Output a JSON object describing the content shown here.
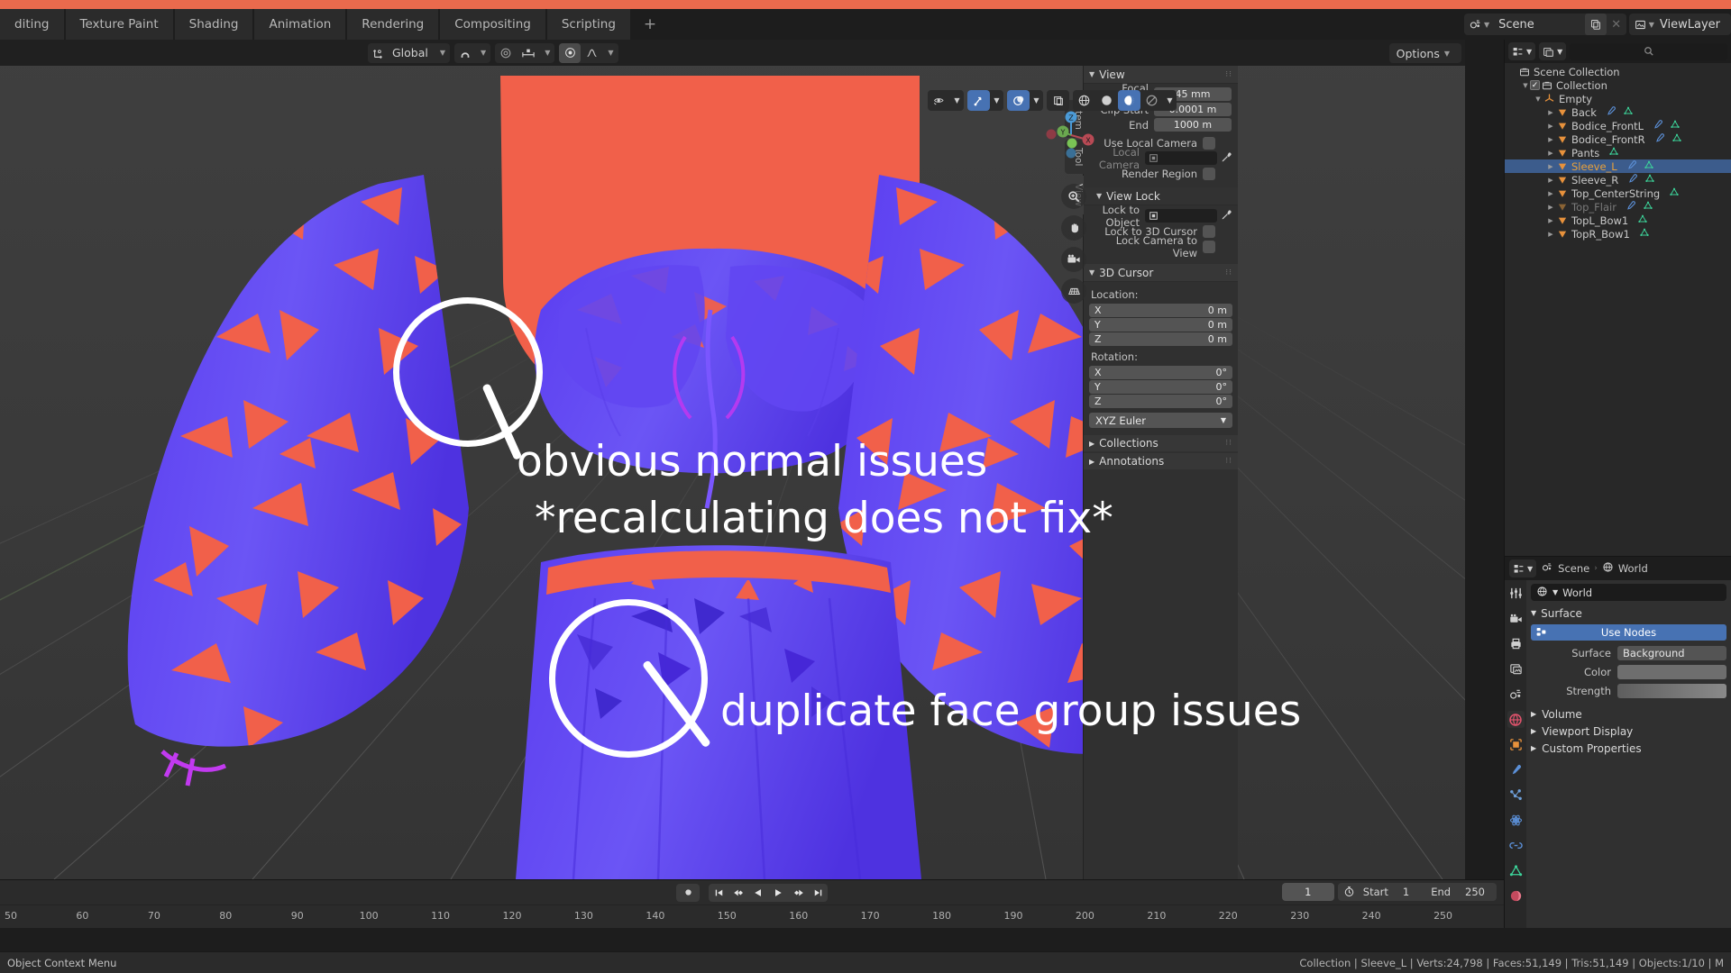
{
  "app": {
    "accent_orange": "#ea6a4d",
    "accent_blue": "#4772b3",
    "scene_name": "Scene",
    "viewlayer_name": "ViewLayer"
  },
  "workspace_tabs": [
    {
      "label": "diting"
    },
    {
      "label": "Texture Paint"
    },
    {
      "label": "Shading"
    },
    {
      "label": "Animation"
    },
    {
      "label": "Rendering"
    },
    {
      "label": "Compositing"
    },
    {
      "label": "Scripting"
    },
    {
      "label": "+"
    }
  ],
  "viewport_header": {
    "orientation": "Global",
    "options_label": "Options"
  },
  "n_panel": {
    "tabs": [
      {
        "label": "Item"
      },
      {
        "label": "Tool"
      },
      {
        "label": "View"
      }
    ],
    "active_tab": "View",
    "view_section": {
      "title": "View",
      "focal_length_label": "Focal Length",
      "focal_length_value": "45 mm",
      "clip_start_label": "Clip Start",
      "clip_start_value": "0.0001 m",
      "clip_end_label": "End",
      "clip_end_value": "1000 m",
      "use_local_camera_label": "Use Local Camera",
      "local_camera_label": "Local Camera",
      "render_region_label": "Render Region"
    },
    "view_lock_section": {
      "title": "View Lock",
      "lock_to_object_label": "Lock to Object",
      "lock_to_3d_cursor_label": "Lock to 3D Cursor",
      "lock_camera_to_view_label": "Lock Camera to View"
    },
    "cursor_section": {
      "title": "3D Cursor",
      "location_label": "Location:",
      "location": [
        {
          "axis": "X",
          "value": "0 m"
        },
        {
          "axis": "Y",
          "value": "0 m"
        },
        {
          "axis": "Z",
          "value": "0 m"
        }
      ],
      "rotation_label": "Rotation:",
      "rotation": [
        {
          "axis": "X",
          "value": "0°"
        },
        {
          "axis": "Y",
          "value": "0°"
        },
        {
          "axis": "Z",
          "value": "0°"
        }
      ],
      "rotation_mode": "XYZ Euler"
    },
    "collapsed": [
      {
        "label": "Collections"
      },
      {
        "label": "Annotations"
      }
    ]
  },
  "outliner": {
    "search_placeholder": "",
    "rows": [
      {
        "indent": 0,
        "label": "Scene Collection",
        "icon": "collection-icon",
        "tri": "",
        "checkbox": false,
        "selected": false,
        "dim": false,
        "mods": []
      },
      {
        "indent": 1,
        "label": "Collection",
        "icon": "collection-icon",
        "tri": "down",
        "checkbox": true,
        "selected": false,
        "dim": false,
        "mods": []
      },
      {
        "indent": 2,
        "label": "Empty",
        "icon": "empty-axes-icon",
        "tri": "down",
        "checkbox": false,
        "selected": false,
        "dim": false,
        "mods": []
      },
      {
        "indent": 3,
        "label": "Back",
        "icon": "mesh-icon",
        "tri": "right",
        "checkbox": false,
        "selected": false,
        "dim": false,
        "mods": [
          "modifier-icon",
          "mesh-data-icon"
        ]
      },
      {
        "indent": 3,
        "label": "Bodice_FrontL",
        "icon": "mesh-icon",
        "tri": "right",
        "checkbox": false,
        "selected": false,
        "dim": false,
        "mods": [
          "modifier-icon",
          "mesh-data-icon"
        ]
      },
      {
        "indent": 3,
        "label": "Bodice_FrontR",
        "icon": "mesh-icon",
        "tri": "right",
        "checkbox": false,
        "selected": false,
        "dim": false,
        "mods": [
          "modifier-icon",
          "mesh-data-icon"
        ]
      },
      {
        "indent": 3,
        "label": "Pants",
        "icon": "mesh-icon",
        "tri": "right",
        "checkbox": false,
        "selected": false,
        "dim": false,
        "mods": [
          "mesh-data-icon"
        ]
      },
      {
        "indent": 3,
        "label": "Sleeve_L",
        "icon": "mesh-icon",
        "tri": "right",
        "checkbox": false,
        "selected": true,
        "dim": false,
        "mods": [
          "modifier-icon",
          "mesh-data-icon"
        ]
      },
      {
        "indent": 3,
        "label": "Sleeve_R",
        "icon": "mesh-icon",
        "tri": "right",
        "checkbox": false,
        "selected": false,
        "dim": false,
        "mods": [
          "modifier-icon",
          "mesh-data-icon"
        ]
      },
      {
        "indent": 3,
        "label": "Top_CenterString",
        "icon": "mesh-icon",
        "tri": "right",
        "checkbox": false,
        "selected": false,
        "dim": false,
        "mods": [
          "mesh-data-icon"
        ]
      },
      {
        "indent": 3,
        "label": "Top_Flair",
        "icon": "mesh-icon",
        "tri": "right",
        "checkbox": false,
        "selected": false,
        "dim": true,
        "mods": [
          "modifier-icon",
          "mesh-data-icon"
        ]
      },
      {
        "indent": 3,
        "label": "TopL_Bow1",
        "icon": "mesh-icon",
        "tri": "right",
        "checkbox": false,
        "selected": false,
        "dim": false,
        "mods": [
          "mesh-data-icon"
        ]
      },
      {
        "indent": 3,
        "label": "TopR_Bow1",
        "icon": "mesh-icon",
        "tri": "right",
        "checkbox": false,
        "selected": false,
        "dim": false,
        "mods": [
          "mesh-data-icon"
        ]
      }
    ]
  },
  "properties": {
    "breadcrumb_scene": "Scene",
    "breadcrumb_world": "World",
    "id_name": "World",
    "surface_section": "Surface",
    "use_nodes_label": "Use Nodes",
    "surface_label": "Surface",
    "surface_value": "Background",
    "color_label": "Color",
    "strength_label": "Strength",
    "collapsed": [
      {
        "label": "Volume"
      },
      {
        "label": "Viewport Display"
      },
      {
        "label": "Custom Properties"
      }
    ]
  },
  "timeline": {
    "current_frame": "1",
    "start_label": "Start",
    "start_value": "1",
    "end_label": "End",
    "end_value": "250",
    "ruler_ticks": [
      "50",
      "60",
      "70",
      "80",
      "90",
      "100",
      "110",
      "120",
      "130",
      "140",
      "150",
      "160",
      "170",
      "180",
      "190",
      "200",
      "210",
      "220",
      "230",
      "240",
      "250"
    ]
  },
  "status_bar": {
    "left": "Object Context Menu",
    "right": "Collection | Sleeve_L | Verts:24,798 | Faces:51,149 | Tris:51,149 | Objects:1/10 | M"
  },
  "annotations": [
    {
      "text": "obvious normal issues"
    },
    {
      "text": "*recalculating does not fix*"
    },
    {
      "text": "duplicate face group issues"
    }
  ]
}
